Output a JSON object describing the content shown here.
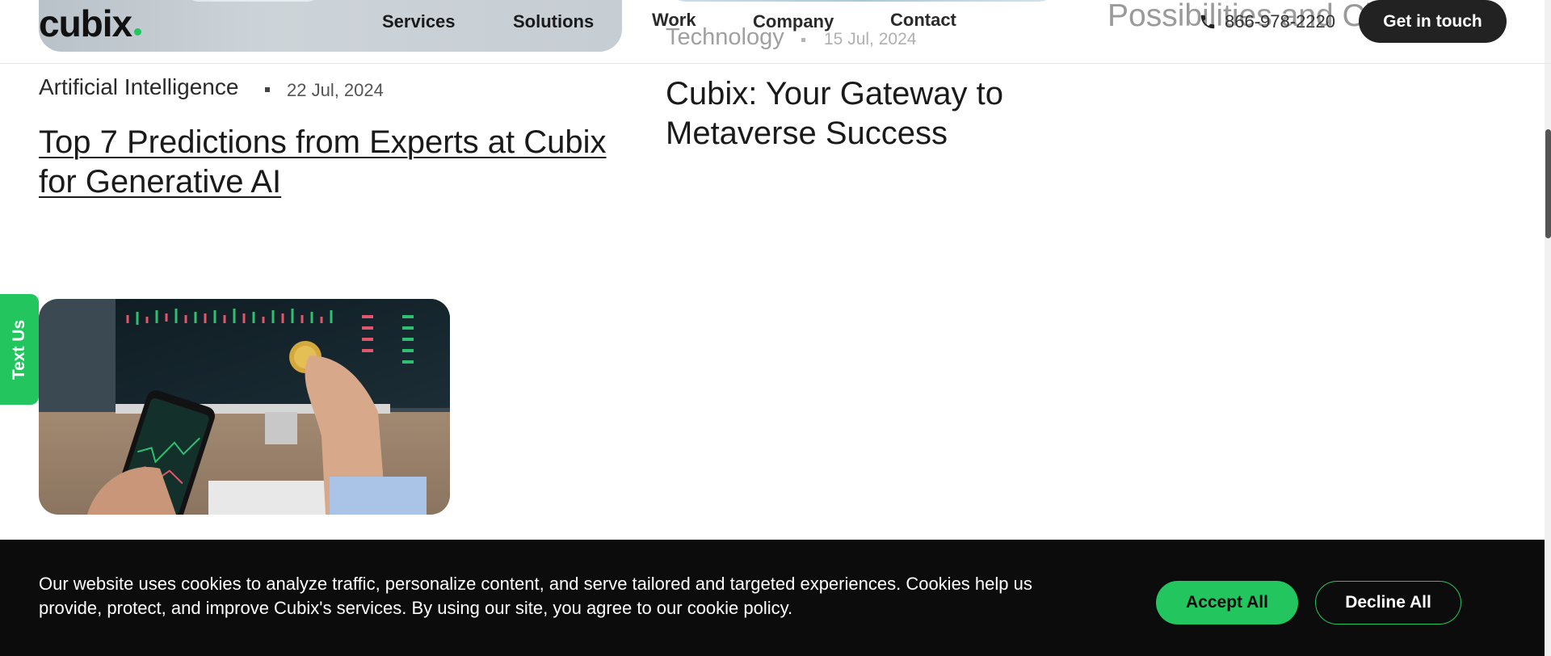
{
  "header": {
    "logo": "cubix",
    "nav": [
      "Services",
      "Solutions",
      "Work",
      "Company",
      "Contact"
    ],
    "phone": "866-978-2220",
    "cta_label": "Get in touch"
  },
  "background": {
    "category": "Technology",
    "date": "15 Jul, 2024",
    "right_title": "Possibilities and Challenges"
  },
  "articles": [
    {
      "category": "Artificial Intelligence",
      "date": "22 Jul, 2024",
      "title": "Top 7 Predictions from Experts at Cubix for Generative AI"
    },
    {
      "title": "Cubix: Your Gateway to Metaverse Success"
    }
  ],
  "side_tab": {
    "label": "Text Us"
  },
  "cookie": {
    "text": "Our website uses cookies to analyze traffic, personalize content, and serve tailored and targeted experiences. Cookies help us provide, protect, and improve Cubix's services. By using our site, you agree to our cookie policy.",
    "accept_label": "Accept All",
    "decline_label": "Decline All"
  },
  "colors": {
    "accent": "#22c55e",
    "dark": "#0c0c0d",
    "cta": "#222222"
  }
}
